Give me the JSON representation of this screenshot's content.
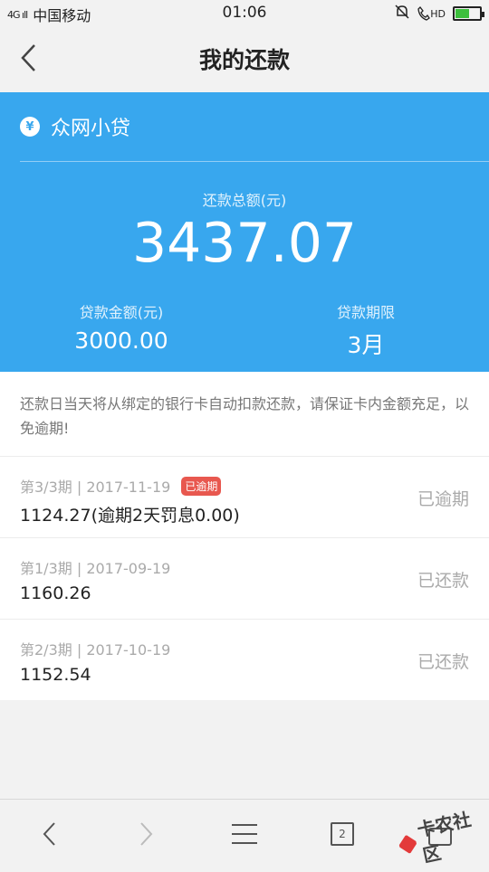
{
  "status_bar": {
    "signal": "4G ıll",
    "carrier": "中国移动",
    "time": "01:06",
    "hd_label": "HD",
    "battery_level": 0.55
  },
  "nav": {
    "title": "我的还款",
    "back_icon": "chevron-left-icon"
  },
  "loan": {
    "icon_glyph": "¥",
    "lender": "众网小贷",
    "total_label": "还款总额(元)",
    "total_value": "3437.07",
    "principal_label": "贷款金额(元)",
    "principal_value": "3000.00",
    "term_label": "贷款期限",
    "term_value": "3月"
  },
  "notice": {
    "text": "还款日当天将从绑定的银行卡自动扣款还款，请保证卡内金额充足，以免逾期!"
  },
  "installments": [
    {
      "period": "第3/3期 | 2017-11-19",
      "badge": "已逾期",
      "amount": "1124.27(逾期2天罚息0.00)",
      "status": "已逾期"
    },
    {
      "period": "第1/3期 | 2017-09-19",
      "badge": "",
      "amount": "1160.26",
      "status": "已还款"
    },
    {
      "period": "第2/3期 | 2017-10-19",
      "badge": "",
      "amount": "1152.54",
      "status": "已还款"
    }
  ],
  "bottom_bar": {
    "tab_count": "2"
  },
  "watermark": {
    "text": "卡农社区"
  },
  "colors": {
    "accent": "#38a7ee",
    "overdue_badge": "#e8584f"
  }
}
